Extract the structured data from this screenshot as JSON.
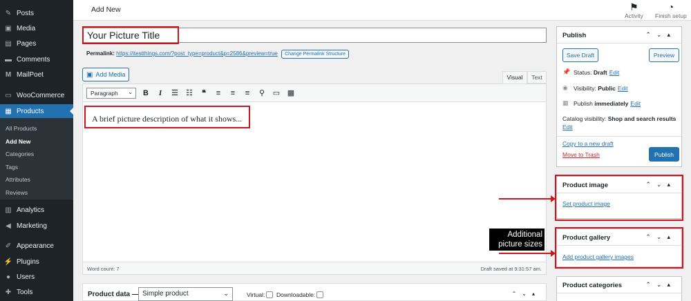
{
  "sidebar": {
    "items": [
      {
        "label": "Posts",
        "icon": "pin-icon"
      },
      {
        "label": "Media",
        "icon": "media-icon"
      },
      {
        "label": "Pages",
        "icon": "pages-icon"
      },
      {
        "label": "Comments",
        "icon": "comment-icon"
      },
      {
        "label": "MailPoet",
        "icon": "mailpoet-icon"
      },
      {
        "label": "WooCommerce",
        "icon": "woo-icon"
      },
      {
        "label": "Products",
        "icon": "archive-icon"
      },
      {
        "label": "Analytics",
        "icon": "analytics-icon"
      },
      {
        "label": "Marketing",
        "icon": "megaphone-icon"
      },
      {
        "label": "Appearance",
        "icon": "brush-icon"
      },
      {
        "label": "Plugins",
        "icon": "plugin-icon"
      },
      {
        "label": "Users",
        "icon": "users-icon"
      },
      {
        "label": "Tools",
        "icon": "wrench-icon"
      }
    ],
    "submenu": [
      "All Products",
      "Add New",
      "Categories",
      "Tags",
      "Attributes",
      "Reviews"
    ]
  },
  "header": {
    "title": "Add New",
    "activity": "Activity",
    "finish_setup": "Finish setup"
  },
  "editor": {
    "title_value": "Your Picture Title",
    "permalink_label": "Permalink:",
    "permalink_url": "https://itestthings.com/?post_type=product&p=2586&preview=true",
    "change_permalink": "Change Permalink Structure",
    "add_media": "Add Media",
    "tab_visual": "Visual",
    "tab_text": "Text",
    "format": "Paragraph",
    "content": "A brief picture description of what it shows...",
    "word_count": "Word count: 7",
    "draft_saved": "Draft saved at 9:31:57 am."
  },
  "product_data": {
    "label": "Product data —",
    "type": "Simple product",
    "virtual": "Virtual:",
    "downloadable": "Downloadable:"
  },
  "publish": {
    "title": "Publish",
    "save_draft": "Save Draft",
    "preview": "Preview",
    "status_label": "Status:",
    "status_value": "Draft",
    "visibility_label": "Visibility:",
    "visibility_value": "Public",
    "publish_label": "Publish",
    "publish_value": "immediately",
    "edit": "Edit",
    "catalog_label": "Catalog visibility:",
    "catalog_value": "Shop and search results",
    "copy_draft": "Copy to a new draft",
    "trash": "Move to Trash",
    "publish_button": "Publish"
  },
  "product_image": {
    "title": "Product image",
    "link": "Set product image"
  },
  "product_gallery": {
    "title": "Product gallery",
    "link": "Add product gallery images"
  },
  "product_categories": {
    "title": "Product categories"
  },
  "annotation": {
    "line1": "Additional",
    "line2": "picture sizes",
    "color": "#d0141b"
  }
}
